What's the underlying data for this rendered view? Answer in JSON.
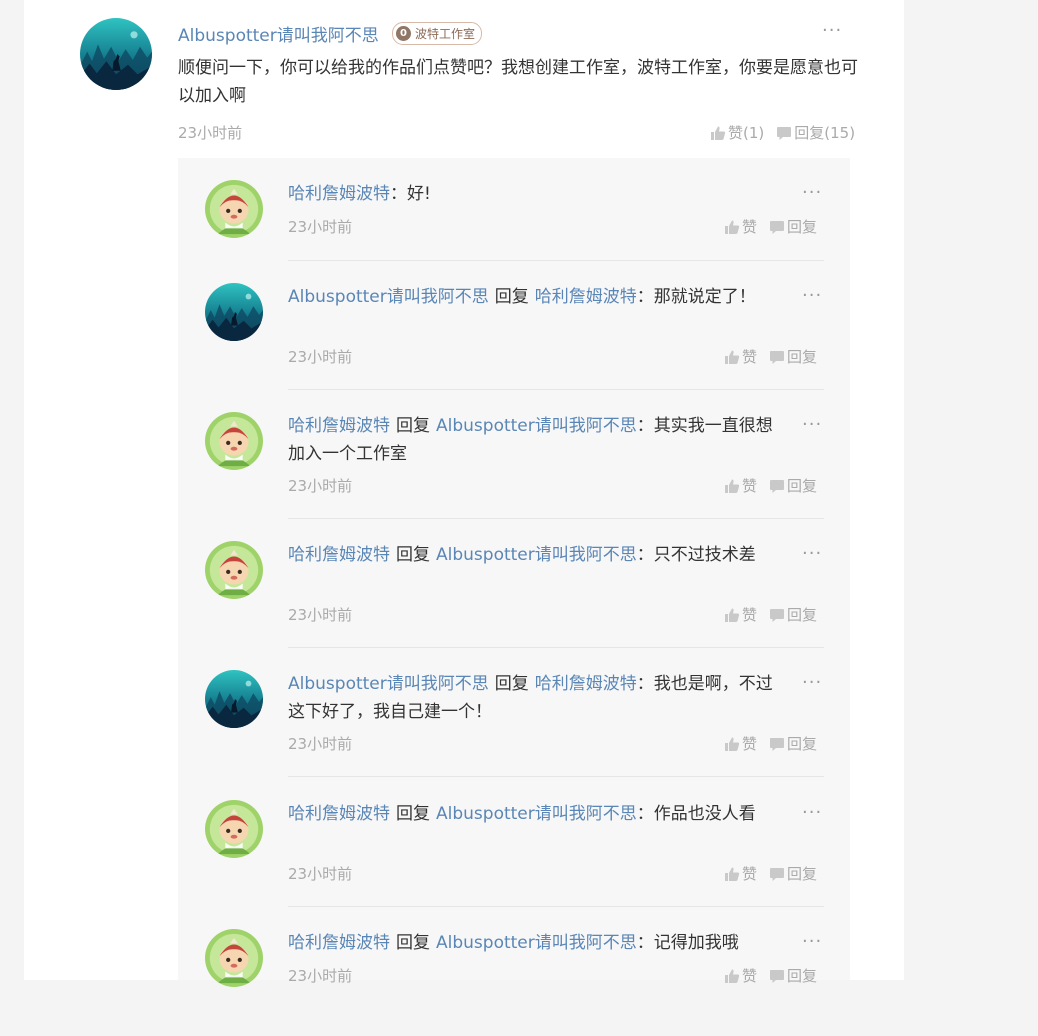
{
  "comment": {
    "author": "Albuspotter请叫我阿不思",
    "badge": {
      "level": "0",
      "label": "波特工作室"
    },
    "more": "···",
    "text": "顺便问一下，你可以给我的作品们点赞吧？我想创建工作室，波特工作室，你要是愿意也可以加入啊",
    "time": "23小时前",
    "like_label": "赞(1)",
    "reply_label": "回复(15)"
  },
  "replies": [
    {
      "author": "哈利詹姆波特",
      "reply_word": "",
      "target": "",
      "sep": "：",
      "text": "好!",
      "time": "23小时前",
      "like": "赞",
      "reply": "回复",
      "avatar": "cartoon-avatar"
    },
    {
      "author": "Albuspotter请叫我阿不思",
      "reply_word": "回复",
      "target": "哈利詹姆波特",
      "sep": "：",
      "text": "那就说定了！",
      "time": "23小时前",
      "like": "赞",
      "reply": "回复",
      "avatar": "forest-avatar"
    },
    {
      "author": "哈利詹姆波特",
      "reply_word": "回复",
      "target": "Albuspotter请叫我阿不思",
      "sep": "：",
      "text": "其实我一直很想加入一个工作室",
      "time": "23小时前",
      "like": "赞",
      "reply": "回复",
      "avatar": "cartoon-avatar"
    },
    {
      "author": "哈利詹姆波特",
      "reply_word": "回复",
      "target": "Albuspotter请叫我阿不思",
      "sep": "：",
      "text": "只不过技术差",
      "time": "23小时前",
      "like": "赞",
      "reply": "回复",
      "avatar": "cartoon-avatar"
    },
    {
      "author": "Albuspotter请叫我阿不思",
      "reply_word": "回复",
      "target": "哈利詹姆波特",
      "sep": "：",
      "text": "我也是啊，不过这下好了，我自己建一个！",
      "time": "23小时前",
      "like": "赞",
      "reply": "回复",
      "avatar": "forest-avatar"
    },
    {
      "author": "哈利詹姆波特",
      "reply_word": "回复",
      "target": "Albuspotter请叫我阿不思",
      "sep": "：",
      "text": "作品也没人看",
      "time": "23小时前",
      "like": "赞",
      "reply": "回复",
      "avatar": "cartoon-avatar"
    },
    {
      "author": "哈利詹姆波特",
      "reply_word": "回复",
      "target": "Albuspotter请叫我阿不思",
      "sep": "：",
      "text": "记得加我哦",
      "time": "23小时前",
      "like": "赞",
      "reply": "回复",
      "avatar": "cartoon-avatar"
    }
  ],
  "more_label": "···",
  "colors": {
    "link": "#5a86b6",
    "muted": "#aaaaaa",
    "panel": "#f7f7f7"
  }
}
